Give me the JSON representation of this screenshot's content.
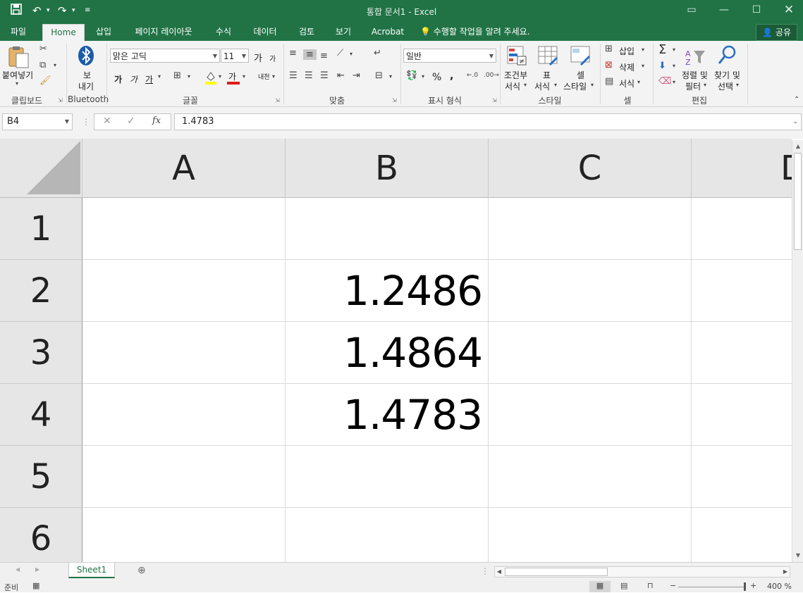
{
  "titlebar": {
    "title": "통합 문서1 - Excel",
    "save_icon": "save-icon",
    "undo_icon": "undo-icon",
    "redo_icon": "redo-icon"
  },
  "tabs": [
    {
      "label": "파일"
    },
    {
      "label": "Home"
    },
    {
      "label": "삽입"
    },
    {
      "label": "페이지 레이아웃"
    },
    {
      "label": "수식"
    },
    {
      "label": "데이터"
    },
    {
      "label": "검토"
    },
    {
      "label": "보기"
    },
    {
      "label": "Acrobat"
    }
  ],
  "tell_me": "수행할 작업을 알려 주세요.",
  "share_label": "공유",
  "ribbon": {
    "clipboard": {
      "paste_label": "붙여넣기",
      "group_label": "클립보드"
    },
    "bluetooth": {
      "send_label_1": "보",
      "send_label_2": "내기",
      "group_label": "Bluetooth"
    },
    "font": {
      "font_name": "맑은 고딕",
      "font_size": "11",
      "group_label": "글꼴",
      "bold": "가",
      "italic": "가",
      "underline": "가",
      "font_color_glyph": "가",
      "grow": "가",
      "shrink": "가",
      "phonetic": "내천"
    },
    "alignment": {
      "group_label": "맞춤"
    },
    "number": {
      "format": "일반",
      "percent": "%",
      "comma": ",",
      "group_label": "표시 형식"
    },
    "styles": {
      "conditional_1": "조건부",
      "conditional_2": "서식",
      "table_1": "표",
      "table_2": "서식",
      "cell_1": "셀",
      "cell_2": "스타일",
      "group_label": "스타일"
    },
    "cells": {
      "insert": "삽입",
      "delete": "삭제",
      "format": "서식",
      "group_label": "셀"
    },
    "editing": {
      "sort_1": "정렬 및",
      "sort_2": "필터",
      "find_1": "찾기 및",
      "find_2": "선택",
      "group_label": "편집"
    }
  },
  "formula_bar": {
    "name_box": "B4",
    "formula": "1.4783",
    "fx": "fx"
  },
  "columns": [
    "A",
    "B",
    "C",
    "D"
  ],
  "rows": [
    "1",
    "2",
    "3",
    "4",
    "5",
    "6"
  ],
  "cells": {
    "B2": "1.2486",
    "B3": "1.4864",
    "B4": "1.4783"
  },
  "sheet_tab": "Sheet1",
  "status": {
    "ready": "준비",
    "zoom": "400 %"
  },
  "accent_color": "#217346"
}
